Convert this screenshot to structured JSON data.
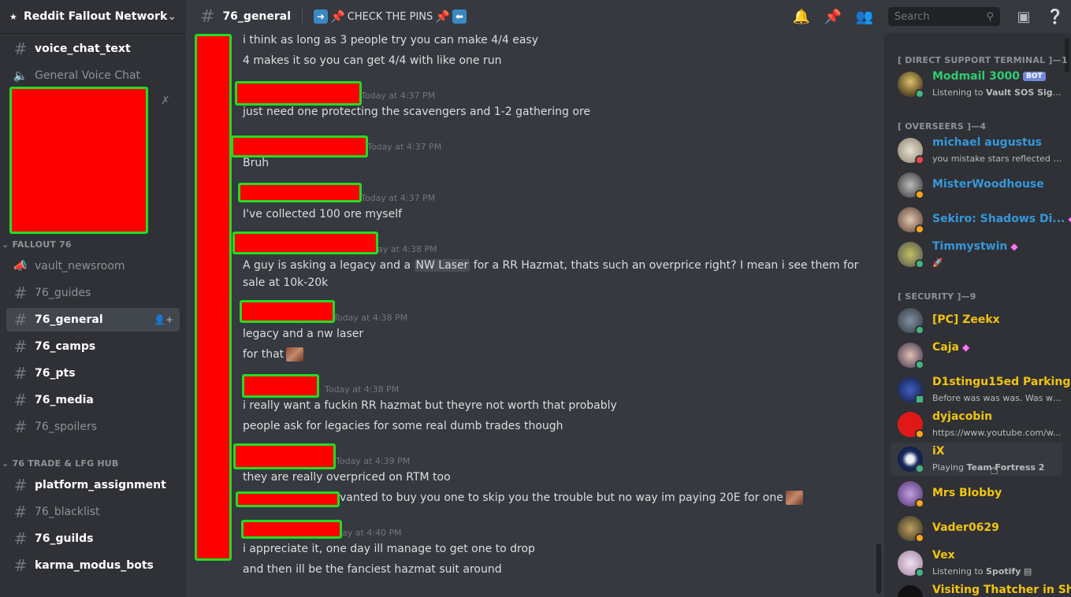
{
  "server": {
    "name": "Reddit Fallout Network",
    "icon": "server-logo-icon"
  },
  "sidebar": {
    "top_channels": [
      {
        "label": "voice_chat_text",
        "kind": "text",
        "unread": true
      },
      {
        "label": "General Voice Chat",
        "kind": "voice",
        "unread": false
      }
    ],
    "categories": [
      {
        "name": "FALLOUT 76",
        "channels": [
          {
            "label": "vault_newsroom",
            "kind": "announcement",
            "unread": false
          },
          {
            "label": "76_guides",
            "kind": "text",
            "unread": false
          },
          {
            "label": "76_general",
            "kind": "text",
            "active": true
          },
          {
            "label": "76_camps",
            "kind": "text",
            "unread": true
          },
          {
            "label": "76_pts",
            "kind": "text",
            "unread": true
          },
          {
            "label": "76_media",
            "kind": "text",
            "unread": true
          },
          {
            "label": "76_spoilers",
            "kind": "text",
            "unread": false
          }
        ]
      },
      {
        "name": "76 TRADE & LFG HUB",
        "channels": [
          {
            "label": "platform_assignment",
            "kind": "text",
            "unread": true
          },
          {
            "label": "76_blacklist",
            "kind": "text",
            "unread": false
          },
          {
            "label": "76_guilds",
            "kind": "text",
            "unread": true
          },
          {
            "label": "karma_modus_bots",
            "kind": "text",
            "unread": true
          }
        ]
      }
    ]
  },
  "topbar": {
    "channel": "76_general",
    "topic_text": "CHECK THE PINS",
    "search_placeholder": "Search",
    "icons": [
      "bell-icon",
      "pin-icon",
      "members-icon",
      "search-icon",
      "inbox-icon",
      "help-icon"
    ]
  },
  "messages": [
    {
      "timestamp": "",
      "lines": [
        "i think as long as 3 people try you can make 4/4 easy",
        "4 makes it so you can get 4/4 with like one run"
      ]
    },
    {
      "timestamp": "Today at 4:37 PM",
      "lines": [
        "just need one protecting the scavengers and 1-2 gathering ore"
      ]
    },
    {
      "timestamp": "Today at 4:37 PM",
      "lines": [
        "Bruh"
      ]
    },
    {
      "timestamp": "Today at 4:37 PM",
      "lines": [
        "I've collected 100 ore myself"
      ]
    },
    {
      "timestamp": "ay at 4:38 PM",
      "lines": [
        "A guy is asking a legacy and a",
        "NW Laser",
        "for a RR Hazmat, thats such an overprice right? I mean i see them for",
        "sale at 10k-20k"
      ]
    },
    {
      "timestamp": "Today at 4:38 PM",
      "lines": [
        "legacy and a nw laser",
        "for that"
      ]
    },
    {
      "timestamp": "Today at 4:38 PM",
      "lines": [
        "i really want a fuckin RR hazmat but theyre not worth that probably",
        "people ask for legacies for some real dumb trades though"
      ]
    },
    {
      "timestamp": "Today at 4:39 PM",
      "lines": [
        "they are really overpriced on RTM too",
        "vanted to buy you one to skip you the trouble but no way im paying 20E for one"
      ]
    },
    {
      "timestamp": "ay at 4:40 PM",
      "lines": [
        "i appreciate it, one day ill manage to get one to drop",
        "and then ill be the fanciest hazmat suit around"
      ]
    }
  ],
  "members": {
    "groups": [
      {
        "title": "[ DIRECT SUPPORT TERMINAL ]—1",
        "members": [
          {
            "name": "Modmail 3000",
            "color": "#2ecc71",
            "bot": "BOT",
            "sub_prefix": "Listening to",
            "sub_bold": "Vault SOS Signals",
            "status": "online"
          }
        ]
      },
      {
        "title": "[ OVERSEERS ]—4",
        "members": [
          {
            "name": "michael augustus",
            "color": "#3498db",
            "sub_prefix": "you mistake stars reflected in ...",
            "sub_bold": "",
            "status": "dnd"
          },
          {
            "name": "MisterWoodhouse",
            "color": "#3498db",
            "sub_prefix": "",
            "sub_bold": "",
            "status": "idle"
          },
          {
            "name": "Sekiro: Shadows Di...",
            "color": "#3498db",
            "sub_prefix": "",
            "sub_bold": "",
            "status": "idle",
            "boost": true
          },
          {
            "name": "Timmystwin",
            "color": "#3498db",
            "sub_prefix": "",
            "sub_bold": "",
            "status": "online",
            "boost": true
          }
        ]
      },
      {
        "title": "[ SECURITY ]—9",
        "members": [
          {
            "name": "[PC] Zeekx",
            "color": "#f1c40f",
            "sub_prefix": "",
            "sub_bold": "",
            "status": "online"
          },
          {
            "name": "Caja",
            "color": "#f1c40f",
            "sub_prefix": "",
            "sub_bold": "",
            "status": "online",
            "boost": true
          },
          {
            "name": "D1stingu15ed Parking",
            "color": "#f1c40f",
            "sub_prefix": "Before was was was. Was was is",
            "sub_bold": "",
            "status": "online"
          },
          {
            "name": "dyjacobin",
            "color": "#f1c40f",
            "sub_prefix": "https://www.youtube.com/w...",
            "sub_bold": "",
            "status": "idle"
          },
          {
            "name": "iX",
            "color": "#f1c40f",
            "sub_prefix": "Playing",
            "sub_bold": "Team Fortress 2",
            "status": "online",
            "hover": true
          },
          {
            "name": "Mrs Blobby",
            "color": "#f1c40f",
            "sub_prefix": "",
            "sub_bold": "",
            "status": "idle"
          },
          {
            "name": "Vader0629",
            "color": "#f1c40f",
            "sub_prefix": "",
            "sub_bold": "",
            "status": "idle"
          },
          {
            "name": "Vex",
            "color": "#f1c40f",
            "sub_prefix": "Listening to",
            "sub_bold": "Spotify",
            "status": "online"
          },
          {
            "name": "Visiting Thatcher in Sh...",
            "color": "#f1c40f",
            "sub_prefix": "",
            "sub_bold": "",
            "status": "online"
          }
        ]
      }
    ]
  },
  "colors": {
    "background": "#36393f",
    "sidebar": "#2f3136",
    "redaction": "#ff0000",
    "redaction_border": "#22dd22"
  }
}
